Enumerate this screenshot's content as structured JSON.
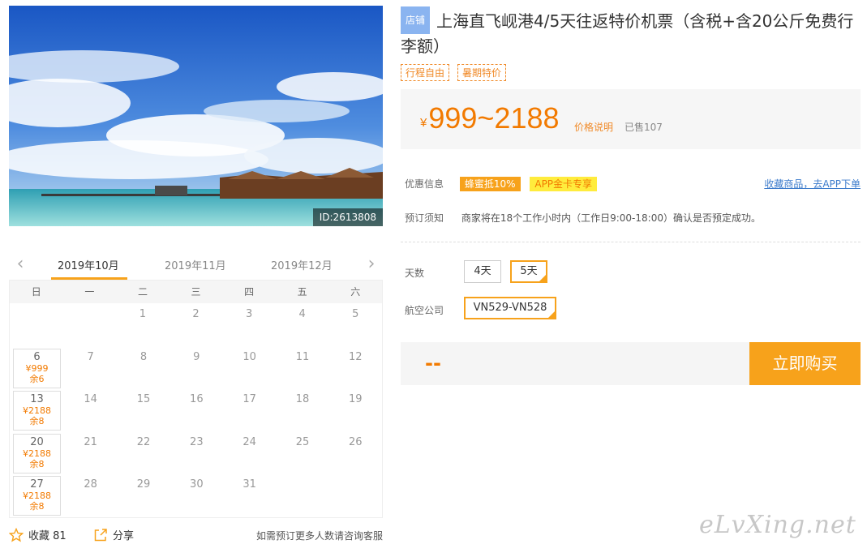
{
  "hero": {
    "id_label": "ID:2613808"
  },
  "calendar": {
    "months": [
      "2019年10月",
      "2019年11月",
      "2019年12月"
    ],
    "weekdays": [
      "日",
      "一",
      "二",
      "三",
      "四",
      "五",
      "六"
    ],
    "row1": [
      "",
      "",
      "1",
      "2",
      "3",
      "4",
      "5"
    ],
    "row2": [
      "7",
      "8",
      "9",
      "10",
      "11",
      "12"
    ],
    "row3": [
      "14",
      "15",
      "16",
      "17",
      "18",
      "19"
    ],
    "row4": [
      "21",
      "22",
      "23",
      "24",
      "25",
      "26"
    ],
    "row5": [
      "28",
      "29",
      "30",
      "31"
    ],
    "avail": [
      {
        "day": "6",
        "price": "¥999",
        "stock": "余6"
      },
      {
        "day": "13",
        "price": "¥2188",
        "stock": "余8"
      },
      {
        "day": "20",
        "price": "¥2188",
        "stock": "余8"
      },
      {
        "day": "27",
        "price": "¥2188",
        "stock": "余8"
      }
    ]
  },
  "bottom": {
    "fav_label": "收藏 81",
    "share_label": "分享",
    "note": "如需预订更多人数请咨询客服"
  },
  "product": {
    "shop_tag": "店铺",
    "title": "上海直飞岘港4/5天往返特价机票（含税+含20公斤免费行李额）",
    "tags": [
      "行程自由",
      "暑期特价"
    ],
    "price_yen": "¥",
    "price": "999~2188",
    "price_note": "价格说明",
    "sold": "已售107"
  },
  "info": {
    "promo_label": "优惠信息",
    "promo1": "蜂蜜抵10%",
    "promo2": "APP金卡专享",
    "fav_link": "收藏商品，去APP下单",
    "notice_label": "预订须知",
    "notice_text": "商家将在18个工作小时内（工作日9:00-18:00）确认是否预定成功。"
  },
  "options": {
    "days_label": "天数",
    "days": [
      "4天",
      "5天"
    ],
    "airline_label": "航空公司",
    "airline": "VN529-VN528"
  },
  "buy": {
    "price": "--",
    "button": "立即购买"
  },
  "watermark": "eLvXing.net",
  "colors": {
    "accent": "#f7a21b",
    "price": "#f27a00",
    "link": "#3d7ccc"
  }
}
